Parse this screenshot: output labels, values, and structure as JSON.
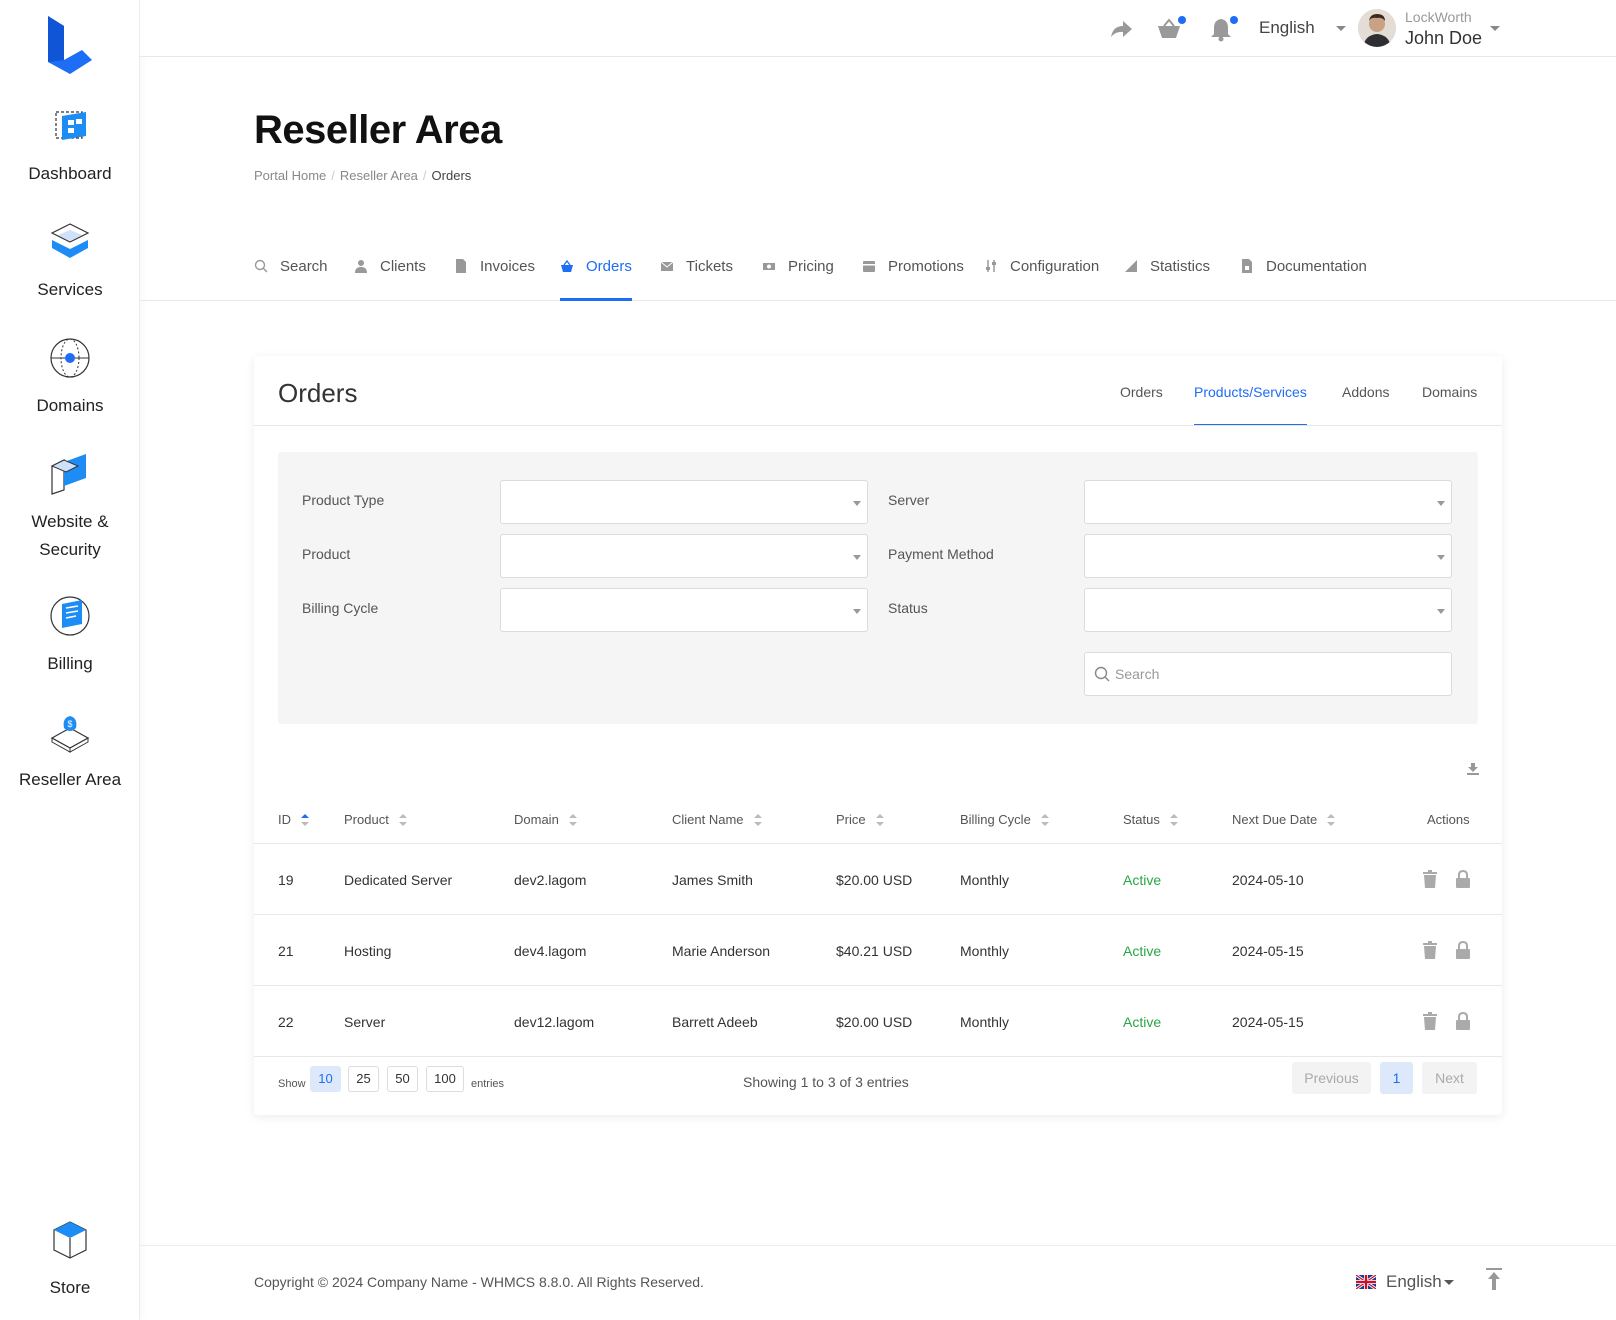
{
  "sidebar": {
    "items": [
      {
        "label": "Dashboard",
        "icon": "dashboard-icon"
      },
      {
        "label": "Services",
        "icon": "services-icon"
      },
      {
        "label": "Domains",
        "icon": "domains-icon"
      },
      {
        "label": "Website &",
        "label2": "Security",
        "icon": "website-security-icon"
      },
      {
        "label": "Billing",
        "icon": "billing-icon"
      },
      {
        "label": "Reseller Area",
        "icon": "reseller-area-icon"
      },
      {
        "label": "Store",
        "icon": "store-icon"
      }
    ]
  },
  "topbar": {
    "language": "English",
    "user_company": "LockWorth",
    "user_name": "John Doe"
  },
  "page": {
    "title": "Reseller Area",
    "breadcrumb": [
      "Portal Home",
      "Reseller Area",
      "Orders"
    ]
  },
  "tabs": [
    {
      "label": "Search",
      "icon": "search-icon"
    },
    {
      "label": "Clients",
      "icon": "user-icon"
    },
    {
      "label": "Invoices",
      "icon": "file-icon"
    },
    {
      "label": "Orders",
      "icon": "basket-icon",
      "active": true
    },
    {
      "label": "Tickets",
      "icon": "envelope-icon"
    },
    {
      "label": "Pricing",
      "icon": "money-icon"
    },
    {
      "label": "Promotions",
      "icon": "wallet-icon"
    },
    {
      "label": "Configuration",
      "icon": "sliders-icon"
    },
    {
      "label": "Statistics",
      "icon": "chart-icon"
    },
    {
      "label": "Documentation",
      "icon": "document-icon"
    }
  ],
  "card": {
    "title": "Orders",
    "subtabs": [
      {
        "label": "Orders"
      },
      {
        "label": "Products/Services",
        "active": true
      },
      {
        "label": "Addons"
      },
      {
        "label": "Domains"
      }
    ],
    "filters": {
      "product_type": "Product Type",
      "product": "Product",
      "billing_cycle": "Billing Cycle",
      "server": "Server",
      "payment_method": "Payment Method",
      "status": "Status",
      "search_placeholder": "Search"
    },
    "table": {
      "columns": [
        "ID",
        "Product",
        "Domain",
        "Client Name",
        "Price",
        "Billing Cycle",
        "Status",
        "Next Due Date",
        "Actions"
      ],
      "rows": [
        {
          "id": "19",
          "product": "Dedicated Server",
          "domain": "dev2.lagom",
          "client": "James Smith",
          "price": "$20.00 USD",
          "cycle": "Monthly",
          "status": "Active",
          "due": "2024-05-10"
        },
        {
          "id": "21",
          "product": "Hosting",
          "domain": "dev4.lagom",
          "client": "Marie Anderson",
          "price": "$40.21 USD",
          "cycle": "Monthly",
          "status": "Active",
          "due": "2024-05-15"
        },
        {
          "id": "22",
          "product": "Server",
          "domain": "dev12.lagom",
          "client": "Barrett Adeeb",
          "price": "$20.00 USD",
          "cycle": "Monthly",
          "status": "Active",
          "due": "2024-05-15"
        }
      ]
    },
    "pagination": {
      "show_label": "Show",
      "lengths": [
        "10",
        "25",
        "50",
        "100"
      ],
      "entries_label": "entries",
      "info": "Showing 1 to 3 of 3 entries",
      "previous": "Previous",
      "page": "1",
      "next": "Next"
    }
  },
  "footer": {
    "copyright": "Copyright © 2024 Company Name - WHMCS 8.8.0. All Rights Reserved.",
    "language": "English"
  },
  "colors": {
    "accent": "#1d6df5",
    "active_status": "#28a745"
  }
}
